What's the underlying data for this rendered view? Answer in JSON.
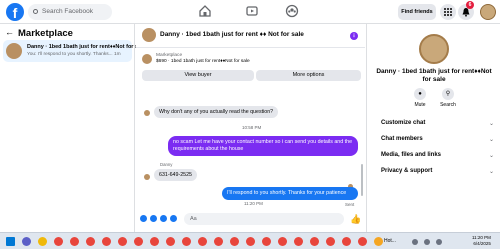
{
  "topbar": {
    "logo": "f",
    "search_placeholder": "Search Facebook",
    "find_friends": "Find friends",
    "notification_count": "6"
  },
  "sidebar": {
    "title": "Marketplace",
    "conversation": {
      "name": "Danny · 1bed 1bath just for rent♦♦Not for sale",
      "preview": "You: I'll respond to you shortly. Thanks...",
      "time": "1m"
    }
  },
  "chat": {
    "title": "Danny · 1bed 1bath just for rent ♦♦ Not for sale",
    "marketplace_label": "Marketplace",
    "marketplace_listing": "$690 · 1bed 1bath just for rent♦♦Not for sale",
    "view_buyer": "View buyer",
    "more_options": "More options",
    "messages": [
      {
        "dir": "in",
        "text": "Why don't any of you actually read the question?"
      },
      {
        "dir": "time",
        "text": "10:58 PM"
      },
      {
        "dir": "out",
        "text": "no scam Let me have your contact number so i can send you details and the requirements about the house"
      },
      {
        "dir": "sender",
        "text": "Danny"
      },
      {
        "dir": "in",
        "text": "631-649-2525"
      },
      {
        "dir": "time",
        "text": "11:20 PM"
      },
      {
        "dir": "out",
        "text": "I'll respond to you shortly. Thanks for your patience"
      },
      {
        "dir": "status",
        "text": "Sent"
      }
    ],
    "composer_placeholder": "Aa"
  },
  "details": {
    "name": "Danny · 1bed 1bath just for rent♦♦Not for sale",
    "mute": "Mute",
    "search": "Search",
    "sections": [
      "Customize chat",
      "Chat members",
      "Media, files and links",
      "Privacy & support"
    ]
  },
  "taskbar": {
    "weather": "Hot...",
    "time": "11:20 PM",
    "date": "6/4/2025"
  },
  "colors": {
    "brand": "#1877f2",
    "purple_bubble": "#7b2cf2",
    "selected_bg": "#e7f3ff"
  }
}
